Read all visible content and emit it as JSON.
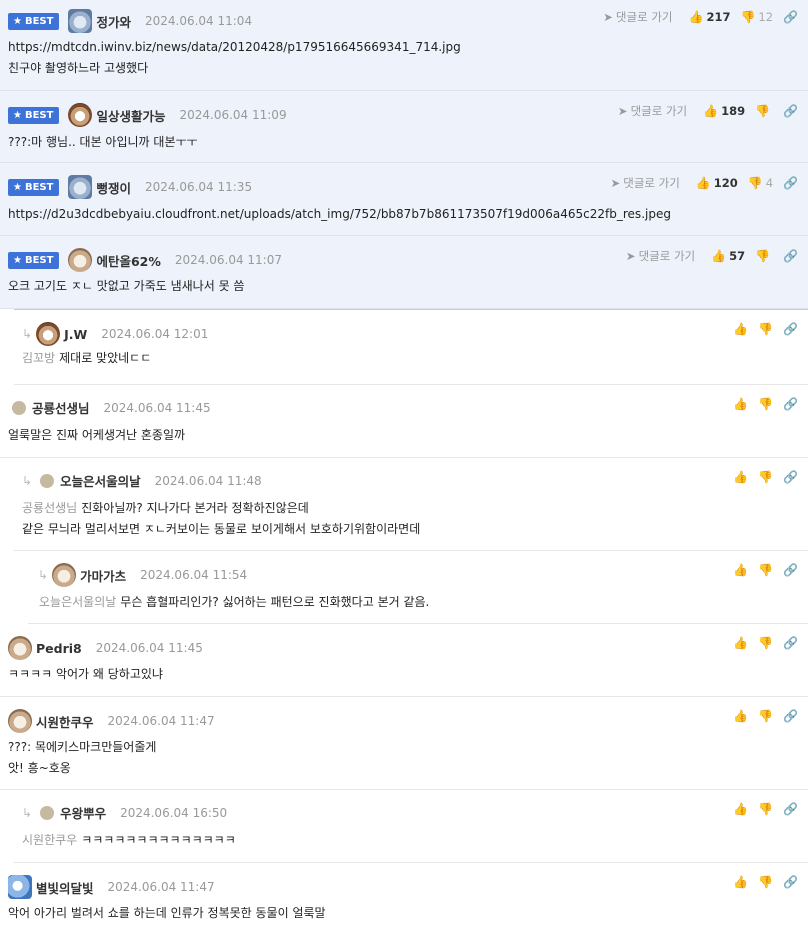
{
  "ui": {
    "best_label": "BEST",
    "goto_label": "댓글로 가기"
  },
  "comments": [
    {
      "nick": "정가와",
      "date": "2024.06.04 11:04",
      "likes": "217",
      "dislikes": "12",
      "line1": "https://mdtcdn.iwinv.biz/news/data/20120428/p179516645669341_714.jpg",
      "line2": "친구야 촬영하느라 고생했다"
    },
    {
      "nick": "일상생활가능",
      "date": "2024.06.04 11:09",
      "likes": "189",
      "dislikes": "",
      "line1": "???:마 행님.. 대본 아입니까 대본ㅜㅜ"
    },
    {
      "nick": "뻥쟁이",
      "date": "2024.06.04 11:35",
      "likes": "120",
      "dislikes": "4",
      "line1": "https://d2u3dcdbebyaiu.cloudfront.net/uploads/atch_img/752/bb87b7b861173507f19d006a465c22fb_res.jpeg"
    },
    {
      "nick": "에탄올62%",
      "date": "2024.06.04 11:07",
      "likes": "57",
      "dislikes": "",
      "line1": "오크 고기도 ㅈㄴ 맛없고 가죽도 냄새나서 못 씀"
    },
    {
      "nick": "J.W",
      "date": "2024.06.04 12:01",
      "mention": "김꼬방",
      "line1": "제대로 맞았네ㄷㄷ"
    },
    {
      "nick": "공룡선생님",
      "date": "2024.06.04 11:45",
      "line1": "얼룩말은 진짜 어케생겨난 혼종일까"
    },
    {
      "nick": "오늘은서울의날",
      "date": "2024.06.04 11:48",
      "mention": "공룡선생님",
      "line1": "진화아닐까? 지나가다 본거라 정확하진않은데",
      "line2": "같은 무늬라 멀리서보면 ㅈㄴ커보이는 동물로 보이게해서 보호하기위함이라면데"
    },
    {
      "nick": "가마가츠",
      "date": "2024.06.04 11:54",
      "mention": "오늘은서울의날",
      "line1": "무슨 흡혈파리인가? 싫어하는 패턴으로 진화했다고 본거 같음."
    },
    {
      "nick": "Pedri8",
      "date": "2024.06.04 11:45",
      "line1": "ㅋㅋㅋㅋ 악어가 왜 당하고있냐"
    },
    {
      "nick": "시원한쿠우",
      "date": "2024.06.04 11:47",
      "line1": "???: 목에키스마크만들어줄게",
      "line2": "앗! 흥~호옹"
    },
    {
      "nick": "우왕뿌우",
      "date": "2024.06.04 16:50",
      "mention": "시원한쿠우",
      "line1": "ㅋㅋㅋㅋㅋㅋㅋㅋㅋㅋㅋㅋㅋㅋ"
    },
    {
      "nick": "별빛의달빛",
      "date": "2024.06.04 11:47",
      "line1": "악어 아가리 벌려서 쇼를 하는데 인류가 정복못한 동물이 얼룩말"
    }
  ],
  "icons": {
    "thumb_up": "thumbs-up-icon",
    "thumb_down": "thumbs-down-icon",
    "link": "link-icon",
    "goto": "arrow-icon",
    "reply": "reply-arrow-icon",
    "star": "star-icon"
  },
  "colors": {
    "best_bg": "#edf2fb",
    "badge": "#3d73d9"
  }
}
